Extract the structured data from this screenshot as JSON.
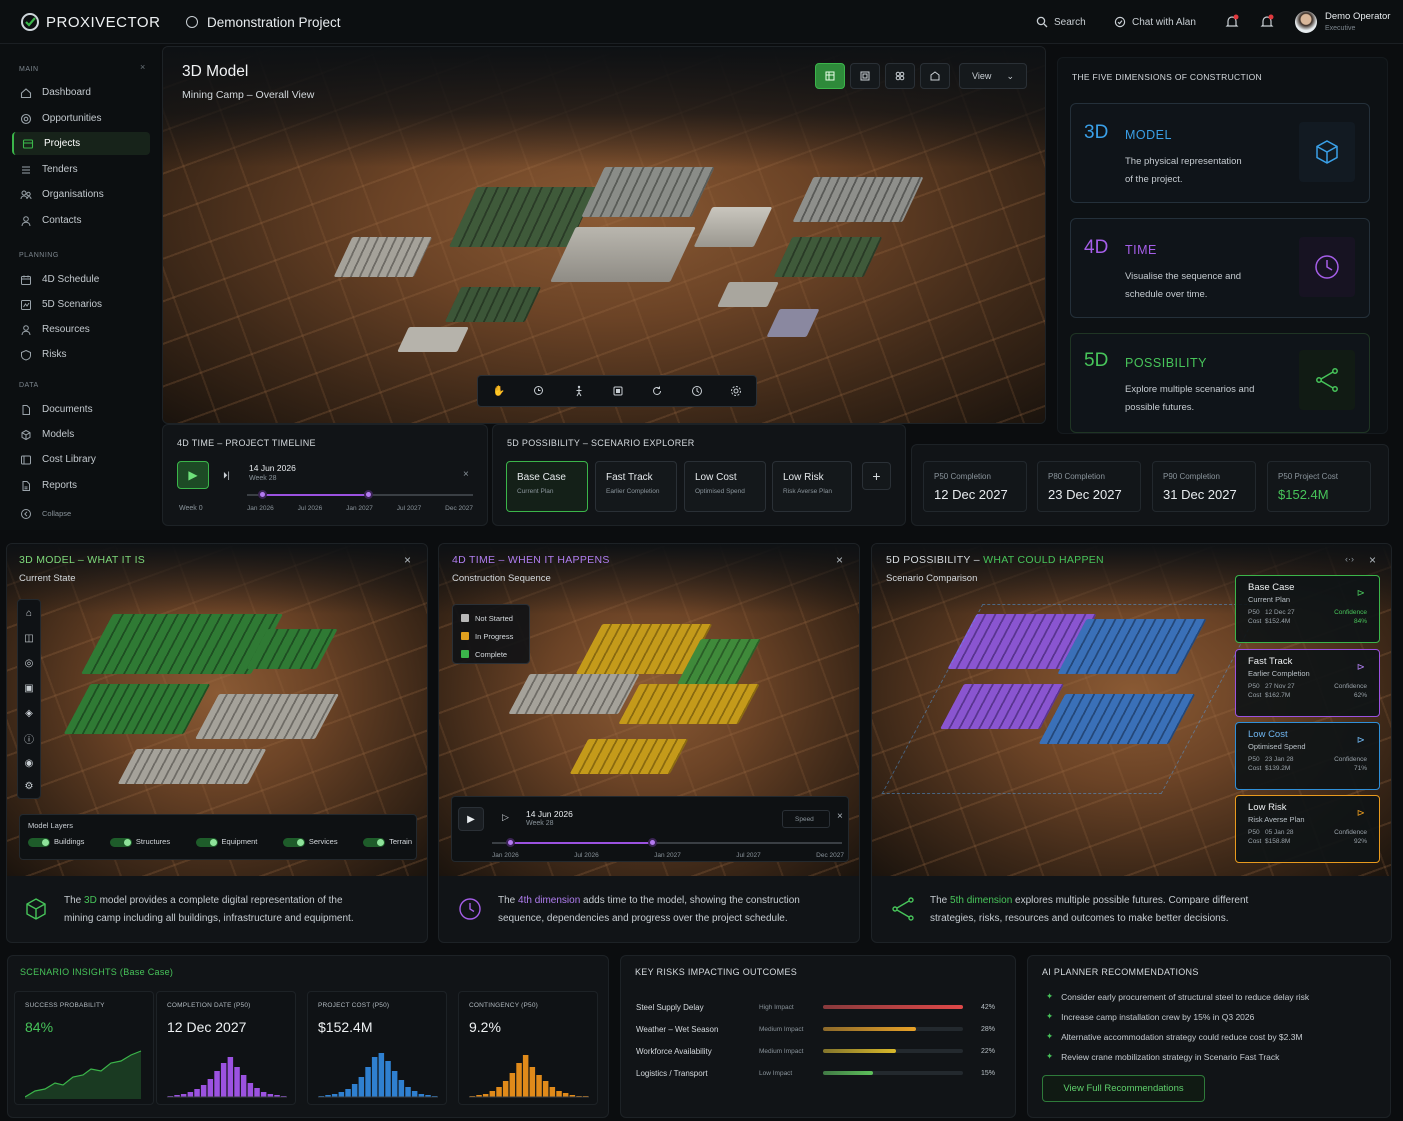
{
  "brand": {
    "name": "PROXIVECTOR"
  },
  "header": {
    "project": "Demonstration Project",
    "search": "Search",
    "chat": "Chat with Alan",
    "user_name": "Demo Operator",
    "user_role": "Executive"
  },
  "sidebar": {
    "main_label": "MAIN",
    "planning_label": "PLANNING",
    "data_label": "DATA",
    "collapse": "Collapse",
    "main": [
      {
        "label": "Dashboard"
      },
      {
        "label": "Opportunities"
      },
      {
        "label": "Projects"
      },
      {
        "label": "Tenders"
      },
      {
        "label": "Organisations"
      },
      {
        "label": "Contacts"
      }
    ],
    "planning": [
      {
        "label": "4D Schedule"
      },
      {
        "label": "5D Scenarios"
      },
      {
        "label": "Resources"
      },
      {
        "label": "Risks"
      }
    ],
    "data": [
      {
        "label": "Documents"
      },
      {
        "label": "Models"
      },
      {
        "label": "Cost Library"
      },
      {
        "label": "Reports"
      }
    ]
  },
  "viewer": {
    "title": "3D Model",
    "subtitle": "Mining Camp – Overall View",
    "view_label": "View"
  },
  "dimensions": {
    "title": "THE FIVE DIMENSIONS OF CONSTRUCTION",
    "cards": [
      {
        "dim": "3D",
        "name": "MODEL",
        "line1": "The physical representation",
        "line2": "of the project.",
        "color": "#3aa0e8"
      },
      {
        "dim": "4D",
        "name": "TIME",
        "line1": "Visualise the sequence and",
        "line2": "schedule over time.",
        "color": "#a55ee8"
      },
      {
        "dim": "5D",
        "name": "POSSIBILITY",
        "line1": "Explore multiple scenarios and",
        "line2": "possible futures.",
        "color": "#47c45a"
      }
    ]
  },
  "timeline": {
    "title": "4D TIME – PROJECT TIMELINE",
    "date": "14 Jun 2026",
    "week": "Week 28",
    "week0": "Week 0",
    "ticks": [
      "Jan 2026",
      "Jul 2026",
      "Jan 2027",
      "Jul 2027",
      "Dec 2027"
    ]
  },
  "scenarios": {
    "title": "5D POSSIBILITY – SCENARIO EXPLORER",
    "items": [
      {
        "title": "Base Case",
        "sub": "Current Plan"
      },
      {
        "title": "Fast Track",
        "sub": "Earlier Completion"
      },
      {
        "title": "Low Cost",
        "sub": "Optimised Spend"
      },
      {
        "title": "Low Risk",
        "sub": "Risk Averse Plan"
      }
    ],
    "add": "+"
  },
  "kpis": [
    {
      "label": "P50 Completion",
      "value": "12 Dec 2027"
    },
    {
      "label": "P80 Completion",
      "value": "23 Dec 2027"
    },
    {
      "label": "P90 Completion",
      "value": "31 Dec 2027"
    },
    {
      "label": "P50 Project Cost",
      "value": "$152.4M"
    }
  ],
  "panel3d": {
    "title": "3D MODEL – WHAT IT IS",
    "subtitle": "Current State",
    "layers_title": "Model Layers",
    "layers": [
      "Buildings",
      "Structures",
      "Equipment",
      "Services",
      "Terrain"
    ],
    "desc_pre": "The ",
    "desc_hl": "3D",
    "desc_mid": " model provides a complete digital representation of the",
    "desc_line2": "mining camp including all buildings, infrastructure and equipment."
  },
  "panel4d": {
    "title": "4D TIME – WHEN IT HAPPENS",
    "subtitle": "Construction Sequence",
    "legend": [
      "Not Started",
      "In Progress",
      "Complete"
    ],
    "date": "14 Jun 2026",
    "week": "Week 28",
    "speed": "Speed",
    "ticks": [
      "Jan 2026",
      "Jul 2026",
      "Jan 2027",
      "Jul 2027",
      "Dec 2027"
    ],
    "desc_pre": "The ",
    "desc_hl": "4th dimension",
    "desc_mid": " adds time to the model, showing the construction",
    "desc_line2": "sequence, dependencies and progress over the project schedule."
  },
  "panel5d": {
    "title_a": "5D POSSIBILITY – ",
    "title_b": "WHAT COULD HAPPEN",
    "subtitle": "Scenario Comparison",
    "cards": [
      {
        "title": "Base Case",
        "sub": "Current Plan",
        "p50_label": "P50",
        "p50": "12 Dec 27",
        "cost_label": "Cost",
        "cost": "$152.4M",
        "conf_label": "Confidence",
        "conf": "84%",
        "color": "#3bb54a"
      },
      {
        "title": "Fast Track",
        "sub": "Earlier Completion",
        "p50_label": "P50",
        "p50": "27 Nov 27",
        "cost_label": "Cost",
        "cost": "$162.7M",
        "conf_label": "Confidence",
        "conf": "62%",
        "color": "#9b52e0"
      },
      {
        "title": "Low Cost",
        "sub": "Optimised Spend",
        "p50_label": "P50",
        "p50": "23 Jan 28",
        "cost_label": "Cost",
        "cost": "$139.2M",
        "conf_label": "Confidence",
        "conf": "71%",
        "color": "#2f8fd8"
      },
      {
        "title": "Low Risk",
        "sub": "Risk Averse Plan",
        "p50_label": "P50",
        "p50": "05 Jan 28",
        "cost_label": "Cost",
        "cost": "$158.8M",
        "conf_label": "Confidence",
        "conf": "92%",
        "color": "#e89a1e"
      }
    ],
    "desc_pre": "The ",
    "desc_hl": "5th dimension",
    "desc_mid": " explores multiple possible futures. Compare different",
    "desc_line2": "strategies, risks, resources and outcomes to make better decisions."
  },
  "insights": {
    "title": "SCENARIO INSIGHTS (Base Case)",
    "items": [
      {
        "label": "SUCCESS PROBABILITY",
        "value": "84%"
      },
      {
        "label": "COMPLETION DATE (P50)",
        "value": "12 Dec 2027"
      },
      {
        "label": "PROJECT COST (P50)",
        "value": "$152.4M"
      },
      {
        "label": "CONTINGENCY (P50)",
        "value": "9.2%"
      }
    ]
  },
  "risks": {
    "title": "KEY RISKS IMPACTING OUTCOMES",
    "items": [
      {
        "name": "Steel Supply Delay",
        "impact": "High Impact",
        "pct": "42%",
        "value": 0.42,
        "color": "#e04848"
      },
      {
        "name": "Weather – Wet Season",
        "impact": "Medium Impact",
        "pct": "28%",
        "value": 0.28,
        "color": "#e8a228"
      },
      {
        "name": "Workforce Availability",
        "impact": "Medium Impact",
        "pct": "22%",
        "value": 0.22,
        "color": "#d8b82a"
      },
      {
        "name": "Logistics / Transport",
        "impact": "Low Impact",
        "pct": "15%",
        "value": 0.15,
        "color": "#5cc05a"
      }
    ]
  },
  "ai": {
    "title": "AI PLANNER RECOMMENDATIONS",
    "items": [
      "Consider early procurement of structural steel to reduce delay risk",
      "Increase camp installation crew by 15% in Q3 2026",
      "Alternative accommodation strategy could reduce cost by $2.3M",
      "Review crane mobilization strategy in Scenario Fast Track"
    ],
    "button": "View Full Recommendations"
  }
}
